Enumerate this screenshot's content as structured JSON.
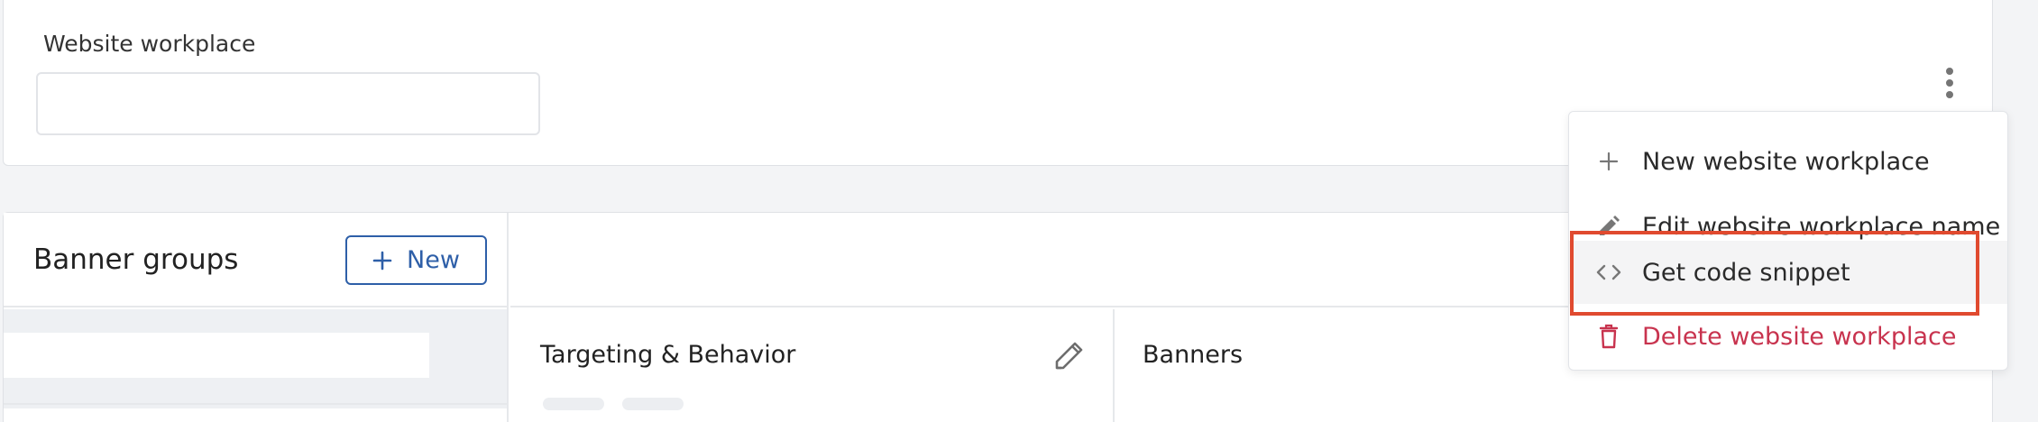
{
  "workplace": {
    "label": "Website workplace",
    "value": "",
    "placeholder": ""
  },
  "banner_groups": {
    "title": "Banner groups",
    "new_label": "New"
  },
  "targeting": {
    "title": "Targeting & Behavior"
  },
  "banners": {
    "title": "Banners"
  },
  "menu": {
    "items": [
      {
        "label": "New website workplace",
        "icon": "plus-icon"
      },
      {
        "label": "Edit website workplace name",
        "icon": "pencil-icon"
      },
      {
        "label": "Get code snippet",
        "icon": "code-icon",
        "state": "hovered"
      },
      {
        "label": "Delete website workplace",
        "icon": "trash-icon",
        "state": "danger"
      }
    ],
    "highlight_color": "#e04a2f"
  },
  "colors": {
    "accent": "#2e5fa8",
    "danger": "#c8334e",
    "highlight": "#e04a2f"
  }
}
